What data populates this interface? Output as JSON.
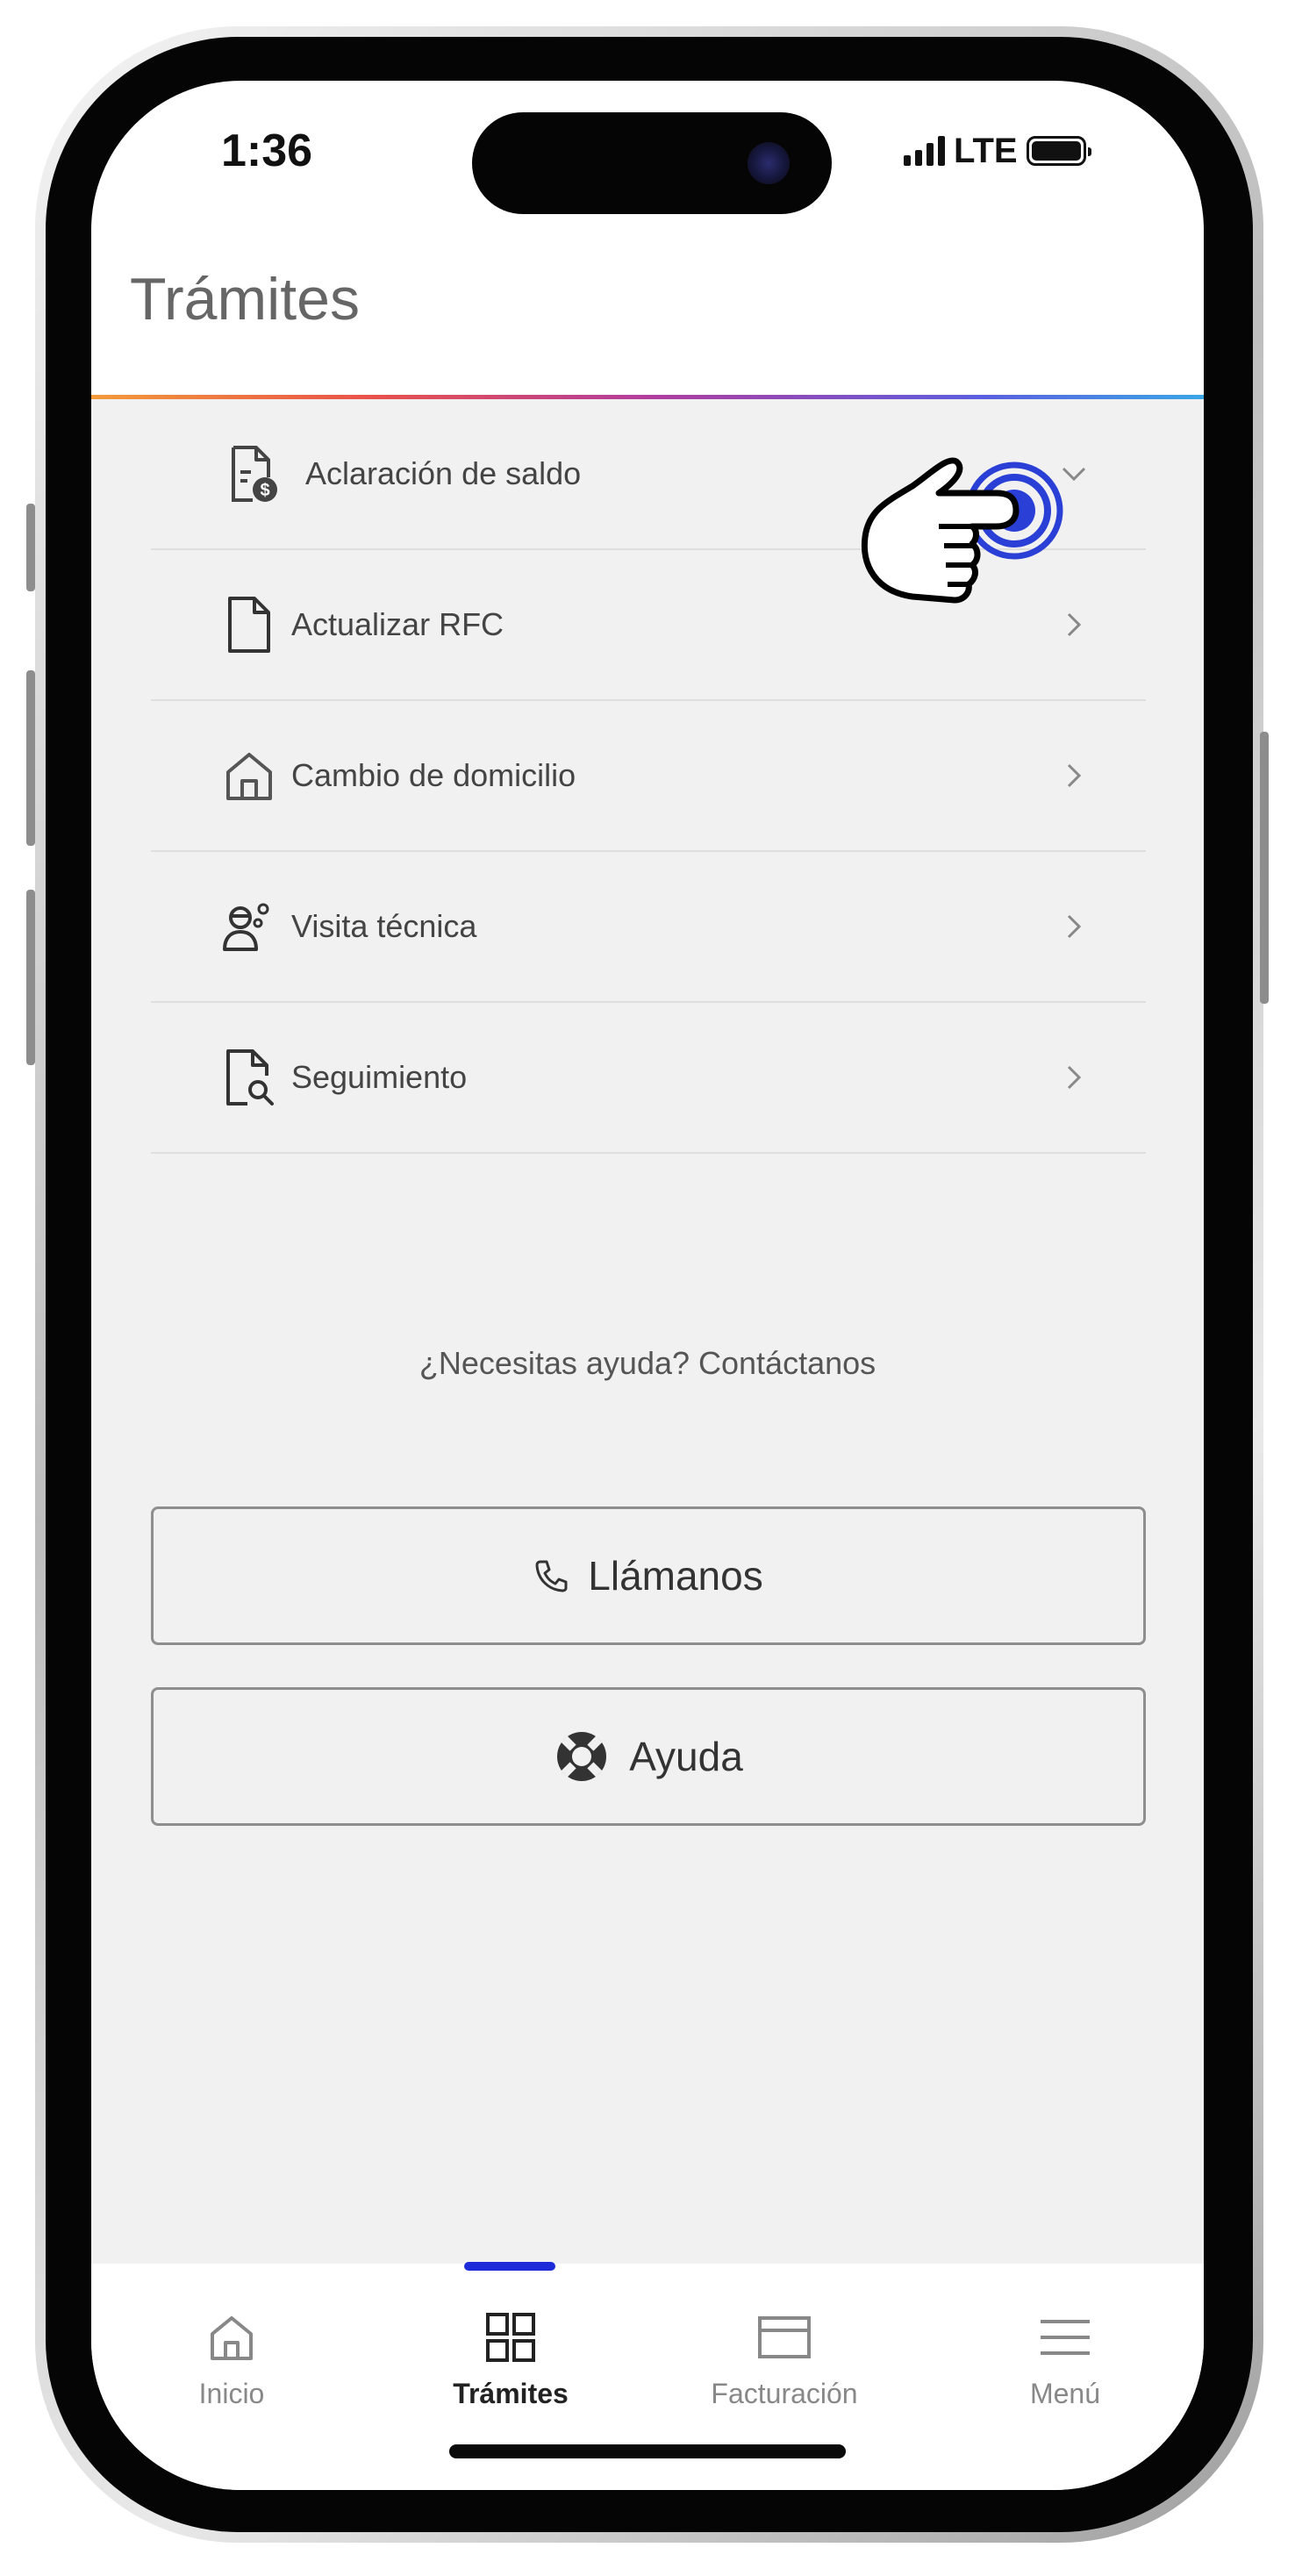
{
  "status_bar": {
    "time": "1:36",
    "network": "LTE"
  },
  "header": {
    "title": "Trámites"
  },
  "list": [
    {
      "label": "Aclaración de saldo",
      "icon": "document-dollar-icon",
      "state": "expanded"
    },
    {
      "label": "Actualizar RFC",
      "icon": "document-icon",
      "state": "collapsed"
    },
    {
      "label": "Cambio de domicilio",
      "icon": "home-icon",
      "state": "collapsed"
    },
    {
      "label": "Visita técnica",
      "icon": "technician-icon",
      "state": "collapsed"
    },
    {
      "label": "Seguimiento",
      "icon": "document-search-icon",
      "state": "collapsed"
    }
  ],
  "help": {
    "prompt": "¿Necesitas ayuda? Contáctanos",
    "call_label": "Llámanos",
    "help_label": "Ayuda"
  },
  "tabbar": {
    "tabs": [
      {
        "label": "Inicio",
        "icon": "home-icon",
        "active": false
      },
      {
        "label": "Trámites",
        "icon": "grid-icon",
        "active": true
      },
      {
        "label": "Facturación",
        "icon": "card-icon",
        "active": false
      },
      {
        "label": "Menú",
        "icon": "hamburger-icon",
        "active": false
      }
    ]
  },
  "colors": {
    "accent": "#1d2bd9",
    "background": "#f1f1f1",
    "text": "#444444",
    "border": "#8e8e8e"
  }
}
